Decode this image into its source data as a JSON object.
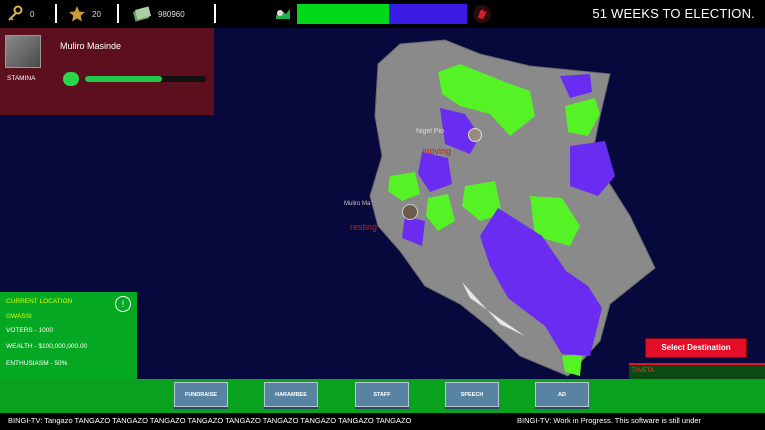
{
  "topbar": {
    "keys_count": "0",
    "stars_count": "20",
    "money_count": "980960",
    "title": "51 WEEKS TO ELECTION.",
    "party_colors": {
      "green": "#00d81a",
      "purple": "#3b1ce6"
    }
  },
  "candidate": {
    "name": "Muliro Masinde",
    "stamina_label": "STAMINA",
    "stamina_level": 0.64
  },
  "map": {
    "candidate_1_name": "Nigel Pio",
    "candidate_1_status": "moving",
    "candidate_2_name": "Muliro Ma",
    "candidate_2_status": "resting"
  },
  "location": {
    "title": "CURRENT LOCATION",
    "name": "GWASSI",
    "voters": "VOTERS - 1000",
    "wealth": "WEALTH - $100,000,000.00",
    "enthusiasm": "ENTHUSIASM - 50%"
  },
  "destination": {
    "button": "Select Destination",
    "item": "TAVETA"
  },
  "actions": [
    "FUNDRAISE",
    "HARAMBEE",
    "STAFF",
    "SPEECH",
    "AD"
  ],
  "ticker": {
    "left": "BINGI-TV: Tangazo TANGAZO TANGAZO TANGAZO TANGAZO TANGAZO TANGAZO TANGAZO TANGAZO TANGAZO",
    "right": "BINGI-TV: Work in Progress. This software is still under"
  }
}
